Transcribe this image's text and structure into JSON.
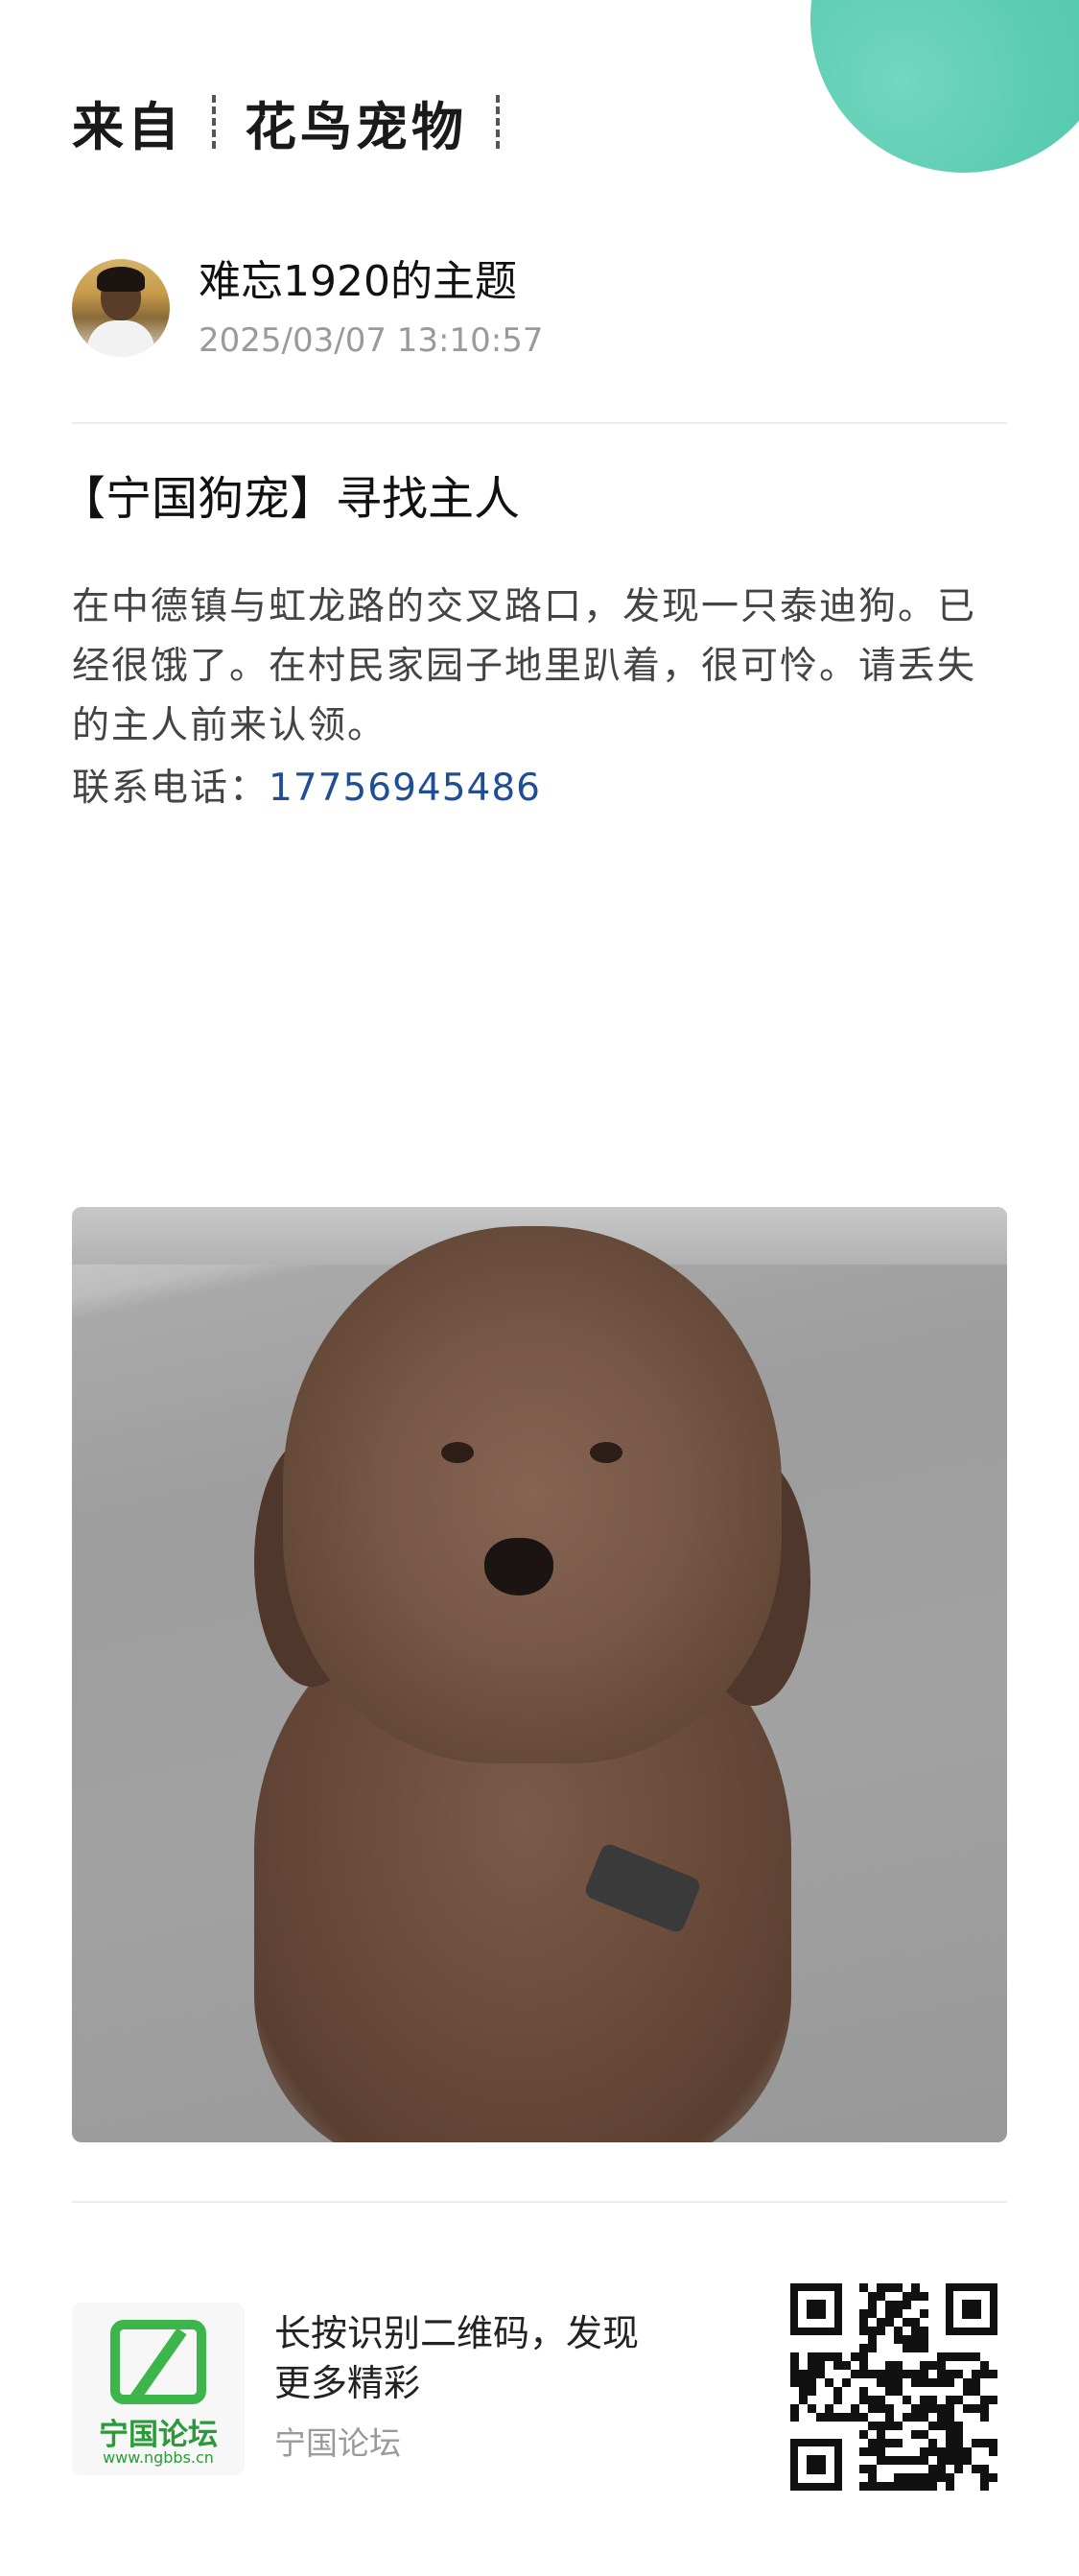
{
  "header": {
    "source_prefix": "来自",
    "source_group": "花鸟宠物"
  },
  "author": {
    "name": "难忘1920的主题",
    "timestamp": "2025/03/07 13:10:57"
  },
  "post": {
    "title": "【宁国狗宠】寻找主人",
    "body": "在中德镇与虹龙路的交叉路口，发现一只泰迪狗。已经很饿了。在村民家园子地里趴着，很可怜。请丢失的主人前来认领。",
    "contact_label": "联系电话：",
    "contact_phone": "17756945486"
  },
  "footer": {
    "logo_text": "宁国论坛",
    "logo_url": "www.ngbbs.cn",
    "cta": "长按识别二维码，发现更多精彩",
    "site_name": "宁国论坛"
  },
  "colors": {
    "accent_green": "#3cb54a",
    "corner_teal": "#5ccdb2",
    "phone_link": "#1f4e96"
  }
}
